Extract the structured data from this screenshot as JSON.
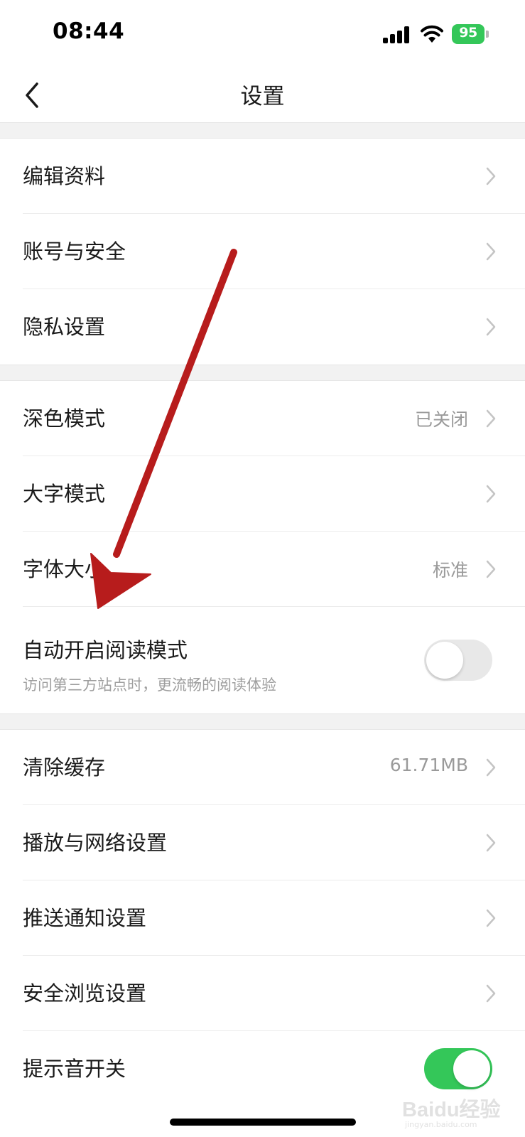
{
  "status_bar": {
    "time": "08:44",
    "battery": "95"
  },
  "nav": {
    "title": "设置"
  },
  "groups": [
    [
      {
        "label": "编辑资料"
      },
      {
        "label": "账号与安全"
      },
      {
        "label": "隐私设置"
      }
    ],
    [
      {
        "label": "深色模式",
        "value": "已关闭"
      },
      {
        "label": "大字模式"
      },
      {
        "label": "字体大小",
        "value": "标准"
      },
      {
        "label": "自动开启阅读模式",
        "sub": "访问第三方站点时，更流畅的阅读体验",
        "toggle": false
      }
    ],
    [
      {
        "label": "清除缓存",
        "value": "61.71MB"
      },
      {
        "label": "播放与网络设置"
      },
      {
        "label": "推送通知设置"
      },
      {
        "label": "安全浏览设置"
      },
      {
        "label": "提示音开关",
        "toggle": true
      }
    ]
  ],
  "watermark": {
    "logo": "Baidu经验",
    "sub": "jingyan.baidu.com"
  },
  "colors": {
    "toggle_on": "#34c759",
    "toggle_off": "#e8e8e8",
    "arrow": "#b71c1c"
  }
}
